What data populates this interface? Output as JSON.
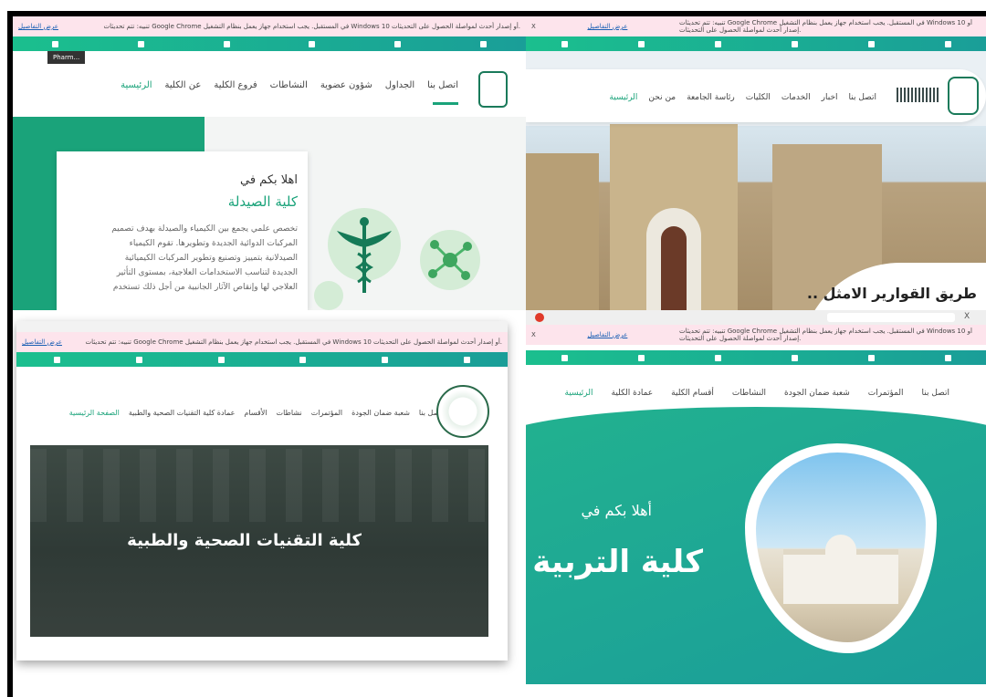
{
  "chrome_warning": {
    "text": "تنبيه: تتم تحديثات Google Chrome في المستقبل. يجب استخدام جهاز يعمل بنظام التشغيل Windows 10 أو إصدار أحدث لمواصلة الحصول على التحديثات.",
    "link": "عرض التفاصيل",
    "close": "X"
  },
  "pharmacy": {
    "tooltip": "Pharm...",
    "nav": [
      "الرئيسية",
      "عن الكلية",
      "فروع الكلية",
      "النشاطات",
      "شؤون عضوية",
      "الجداول",
      "اتصل بنا"
    ],
    "welcome": "اهلا بكم في",
    "college": "كلية الصيدلة",
    "description": [
      "تخصص علمي يجمع بين الكيمياء والصيدلة بهدف تصميم",
      "المركبات الدوائية الجديدة وتطويرها. تقوم الكيمياء",
      "الصيدلانية بتمييز وتصنيع وتطوير المركبات الكيميائية",
      "الجديدة لتناسب الاستخدامات العلاجية، بمستوى التأثير",
      "العلاجي لها وإنقاص الآثار الجانبية من أجل ذلك تستخدم"
    ]
  },
  "university": {
    "nav": [
      "الرئيسية",
      "من نحن",
      "رئاسة الجامعة",
      "الكليات",
      "الخدمات",
      "اخبار",
      "اتصل بنا"
    ],
    "slogan": "طريق القوارير الامثل .."
  },
  "health": {
    "nav": [
      "الصفحة الرئيسية",
      "عمادة كلية التقنيات الصحية والطبية",
      "الأقسام",
      "نشاطات",
      "المؤتمرات",
      "شعبة ضمان الجودة",
      "اتصل بنا"
    ],
    "college": "كلية التقنيات الصحية والطبية"
  },
  "education": {
    "tab_close": "X",
    "nav": [
      "الرئيسية",
      "عمادة الكلية",
      "أقسام الكلية",
      "النشاطات",
      "شعبة ضمان الجودة",
      "المؤتمرات",
      "اتصل بنا"
    ],
    "welcome": "أهلا بكم في",
    "college": "كلية التربية"
  },
  "colors": {
    "primary": "#1aa37a",
    "teal": "#1a9e98",
    "warning_bg": "#fde4ec"
  }
}
